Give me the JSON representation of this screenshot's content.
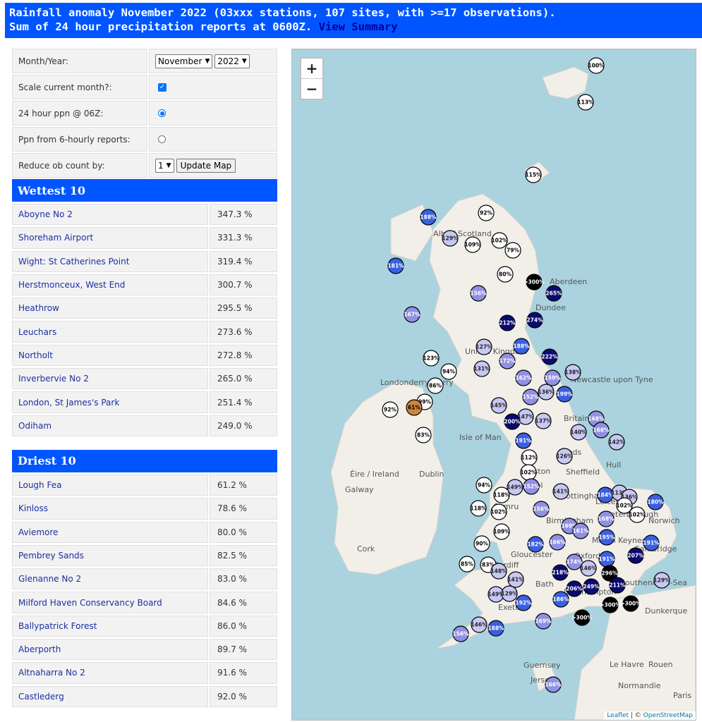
{
  "header": {
    "line1": "Rainfall anomaly November 2022 (03xxx stations, 107 sites, with >=17 observations).",
    "line2": "Sum of 24 hour precipitation reports at 0600Z.",
    "link": "View Summary"
  },
  "controls": {
    "month_label": "Month/Year:",
    "month_value": "November",
    "year_value": "2022",
    "scale_label": "Scale current month?:",
    "ppn24_label": "24 hour ppn @ 06Z:",
    "ppn6_label": "Ppn from 6-hourly reports:",
    "reduce_label": "Reduce ob count by:",
    "reduce_value": "1",
    "update_button": "Update Map"
  },
  "wettest": {
    "title": "Wettest 10",
    "rows": [
      {
        "name": "Aboyne No 2",
        "pct": "347.3 %"
      },
      {
        "name": "Shoreham Airport",
        "pct": "331.3 %"
      },
      {
        "name": "Wight: St Catherines Point",
        "pct": "319.4 %"
      },
      {
        "name": "Herstmonceux, West End",
        "pct": "300.7 %"
      },
      {
        "name": "Heathrow",
        "pct": "295.5 %"
      },
      {
        "name": "Leuchars",
        "pct": "273.6 %"
      },
      {
        "name": "Northolt",
        "pct": "272.8 %"
      },
      {
        "name": "Inverbervie No 2",
        "pct": "265.0 %"
      },
      {
        "name": "London, St James's Park",
        "pct": "251.4 %"
      },
      {
        "name": "Odiham",
        "pct": "249.0 %"
      }
    ]
  },
  "driest": {
    "title": "Driest 10",
    "rows": [
      {
        "name": "Lough Fea",
        "pct": "61.2 %"
      },
      {
        "name": "Kinloss",
        "pct": "78.6 %"
      },
      {
        "name": "Aviemore",
        "pct": "80.0 %"
      },
      {
        "name": "Pembrey Sands",
        "pct": "82.5 %"
      },
      {
        "name": "Glenanne No 2",
        "pct": "83.0 %"
      },
      {
        "name": "Milford Haven Conservancy Board",
        "pct": "84.6 %"
      },
      {
        "name": "Ballypatrick Forest",
        "pct": "86.0 %"
      },
      {
        "name": "Aberporth",
        "pct": "89.7 %"
      },
      {
        "name": "Altnaharra No 2",
        "pct": "91.6 %"
      },
      {
        "name": "Castlederg",
        "pct": "92.0 %"
      }
    ]
  },
  "map": {
    "zoom_in": "+",
    "zoom_out": "−",
    "attribution_leaflet": "Leaflet",
    "attribution_sep": " | © ",
    "attribution_osm": "OpenStreetMap",
    "colors": {
      "sea": "#aad3df",
      "land": "#f2efe9",
      "white": "#ffffff",
      "light": "#c8c8f4",
      "mid": "#9090e4",
      "blue": "#3a5fe0",
      "dark": "#0a0a6e",
      "black": "#000000",
      "dry": "#cd853f"
    },
    "place_labels": [
      "Aberdeen",
      "Dundee",
      "United Kingdom",
      "Newcastle upon Tyne",
      "Londonderry/Derry",
      "Isle of Man",
      "Britain",
      "Éire / Ireland",
      "Dublin",
      "Galway",
      "Sheffield",
      "Hull",
      "Leeds",
      "Nottingham",
      "Birmingham",
      "Norwich",
      "Cambridge",
      "Cardiff",
      "Bath",
      "Gloucester",
      "Cork",
      "Exeter",
      "Southampton",
      "Southend-on-Sea",
      "Dunkerque",
      "Guernsey",
      "Le Havre",
      "Rouen",
      "Normandie",
      "Jersey",
      "Cymru",
      "Preston",
      "Milton Keynes",
      "Oxford",
      "Liverpool",
      "Peterborough",
      "Leicester",
      "Alba / Scotland",
      "Paris"
    ],
    "stations": [
      {
        "label": "100%",
        "tone": "white"
      },
      {
        "label": "113%",
        "tone": "white"
      },
      {
        "label": "115%",
        "tone": "white"
      },
      {
        "label": "188%",
        "tone": "blue"
      },
      {
        "label": "92%",
        "tone": "white"
      },
      {
        "label": "129%",
        "tone": "light"
      },
      {
        "label": "109%",
        "tone": "white"
      },
      {
        "label": "102%",
        "tone": "white"
      },
      {
        "label": "79%",
        "tone": "white"
      },
      {
        "label": "181%",
        "tone": "blue"
      },
      {
        "label": "80%",
        "tone": "white"
      },
      {
        "label": ">300%",
        "tone": "black"
      },
      {
        "label": "265%",
        "tone": "dark"
      },
      {
        "label": "156%",
        "tone": "mid"
      },
      {
        "label": "167%",
        "tone": "mid"
      },
      {
        "label": "212%",
        "tone": "dark"
      },
      {
        "label": "274%",
        "tone": "dark"
      },
      {
        "label": "127%",
        "tone": "light"
      },
      {
        "label": "188%",
        "tone": "blue"
      },
      {
        "label": "123%",
        "tone": "white"
      },
      {
        "label": "94%",
        "tone": "white"
      },
      {
        "label": "131%",
        "tone": "light"
      },
      {
        "label": "172%",
        "tone": "mid"
      },
      {
        "label": "222%",
        "tone": "dark"
      },
      {
        "label": "138%",
        "tone": "light"
      },
      {
        "label": "86%",
        "tone": "white"
      },
      {
        "label": "162%",
        "tone": "mid"
      },
      {
        "label": "159%",
        "tone": "mid"
      },
      {
        "label": "136%",
        "tone": "light"
      },
      {
        "label": "199%",
        "tone": "blue"
      },
      {
        "label": "152%",
        "tone": "mid"
      },
      {
        "label": "99%",
        "tone": "white"
      },
      {
        "label": "92%",
        "tone": "white"
      },
      {
        "label": "61%",
        "tone": "dry"
      },
      {
        "label": "145%",
        "tone": "light"
      },
      {
        "label": "147%",
        "tone": "light"
      },
      {
        "label": "200%",
        "tone": "dark"
      },
      {
        "label": "137%",
        "tone": "light"
      },
      {
        "label": "168%",
        "tone": "mid"
      },
      {
        "label": "168%",
        "tone": "mid"
      },
      {
        "label": "140%",
        "tone": "light"
      },
      {
        "label": "83%",
        "tone": "white"
      },
      {
        "label": "191%",
        "tone": "blue"
      },
      {
        "label": "142%",
        "tone": "light"
      },
      {
        "label": "112%",
        "tone": "white"
      },
      {
        "label": "126%",
        "tone": "light"
      },
      {
        "label": "102%",
        "tone": "white"
      },
      {
        "label": "94%",
        "tone": "white"
      },
      {
        "label": "118%",
        "tone": "white"
      },
      {
        "label": "149%",
        "tone": "light"
      },
      {
        "label": "152%",
        "tone": "mid"
      },
      {
        "label": "141%",
        "tone": "light"
      },
      {
        "label": "184%",
        "tone": "blue"
      },
      {
        "label": "113%",
        "tone": "light"
      },
      {
        "label": "136%",
        "tone": "light"
      },
      {
        "label": "180%",
        "tone": "blue"
      },
      {
        "label": "118%",
        "tone": "white"
      },
      {
        "label": "102%",
        "tone": "white"
      },
      {
        "label": "156%",
        "tone": "mid"
      },
      {
        "label": "168%",
        "tone": "mid"
      },
      {
        "label": "102%",
        "tone": "white"
      },
      {
        "label": "102%",
        "tone": "white"
      },
      {
        "label": "109%",
        "tone": "white"
      },
      {
        "label": "169%",
        "tone": "mid"
      },
      {
        "label": "161%",
        "tone": "mid"
      },
      {
        "label": "195%",
        "tone": "blue"
      },
      {
        "label": "182%",
        "tone": "blue"
      },
      {
        "label": "166%",
        "tone": "mid"
      },
      {
        "label": "191%",
        "tone": "blue"
      },
      {
        "label": "90%",
        "tone": "white"
      },
      {
        "label": "207%",
        "tone": "dark"
      },
      {
        "label": "191%",
        "tone": "blue"
      },
      {
        "label": "174%",
        "tone": "mid"
      },
      {
        "label": "146%",
        "tone": "light"
      },
      {
        "label": "85%",
        "tone": "white"
      },
      {
        "label": "83%",
        "tone": "white"
      },
      {
        "label": "148%",
        "tone": "light"
      },
      {
        "label": "218%",
        "tone": "dark"
      },
      {
        "label": "296%",
        "tone": "black"
      },
      {
        "label": "211%",
        "tone": "dark"
      },
      {
        "label": "141%",
        "tone": "light"
      },
      {
        "label": "206%",
        "tone": "dark"
      },
      {
        "label": "249%",
        "tone": "dark"
      },
      {
        "label": "129%",
        "tone": "light"
      },
      {
        "label": "149%",
        "tone": "light"
      },
      {
        "label": "129%",
        "tone": "light"
      },
      {
        "label": "192%",
        "tone": "blue"
      },
      {
        "label": "186%",
        "tone": "blue"
      },
      {
        "label": ">300%",
        "tone": "black"
      },
      {
        "label": ">300%",
        "tone": "black"
      },
      {
        "label": "146%",
        "tone": "light"
      },
      {
        "label": "188%",
        "tone": "blue"
      },
      {
        "label": "169%",
        "tone": "mid"
      },
      {
        "label": ">300%",
        "tone": "black"
      },
      {
        "label": "156%",
        "tone": "mid"
      },
      {
        "label": "166%",
        "tone": "mid"
      }
    ]
  }
}
